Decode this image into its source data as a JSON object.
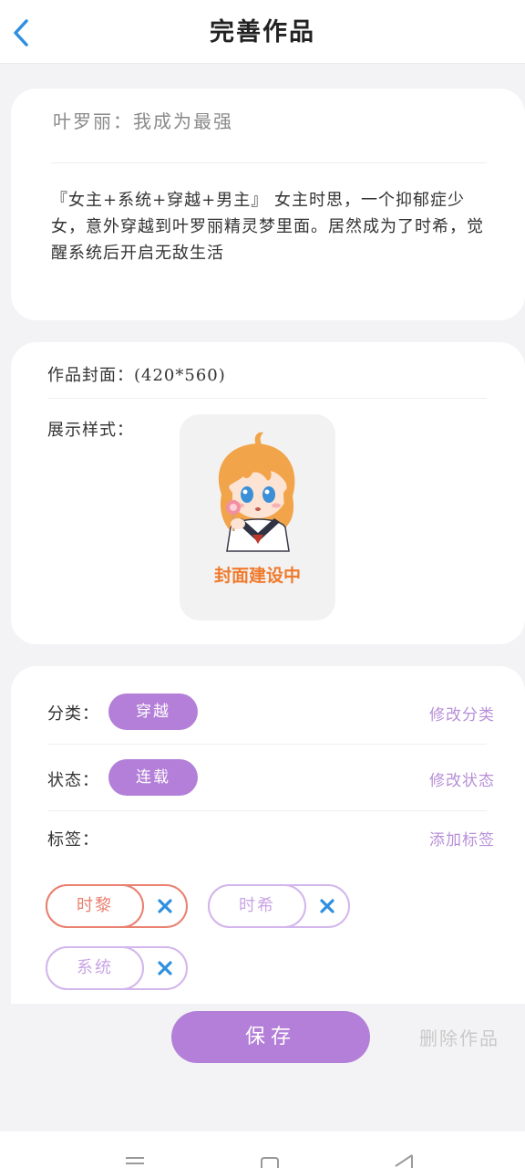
{
  "header": {
    "title": "完善作品",
    "back_icon": "chevron-left-icon"
  },
  "book": {
    "title": "叶罗丽：我成为最强",
    "description": "『女主+系统+穿越+男主』 女主时思，一个抑郁症少女，意外穿越到叶罗丽精灵梦里面。居然成为了时希，觉醒系统后开启无敌生活"
  },
  "cover": {
    "label": "作品封面：(420*560)",
    "style_label": "展示样式：",
    "placeholder_caption": "封面建设中"
  },
  "info": {
    "category_label": "分类：",
    "category_value": "穿越",
    "category_action": "修改分类",
    "status_label": "状态：",
    "status_value": "连载",
    "status_action": "修改状态",
    "tags_label": "标签：",
    "tags_action": "添加标签",
    "tags": [
      {
        "label": "时黎",
        "color": "#e98070"
      },
      {
        "label": "时希",
        "color": "#c9a4e6"
      },
      {
        "label": "系统",
        "color": "#c9a4e6"
      }
    ]
  },
  "actions": {
    "save_label": "保存",
    "delete_label": "删除作品"
  },
  "colors": {
    "accent": "#b37fd8",
    "tag_red": "#e98070",
    "close_x": "#2f8fe0",
    "back_arrow": "#2f8fe0"
  },
  "navbar": {
    "icons": [
      "menu-icon",
      "home-square-icon",
      "back-triangle-icon"
    ]
  }
}
